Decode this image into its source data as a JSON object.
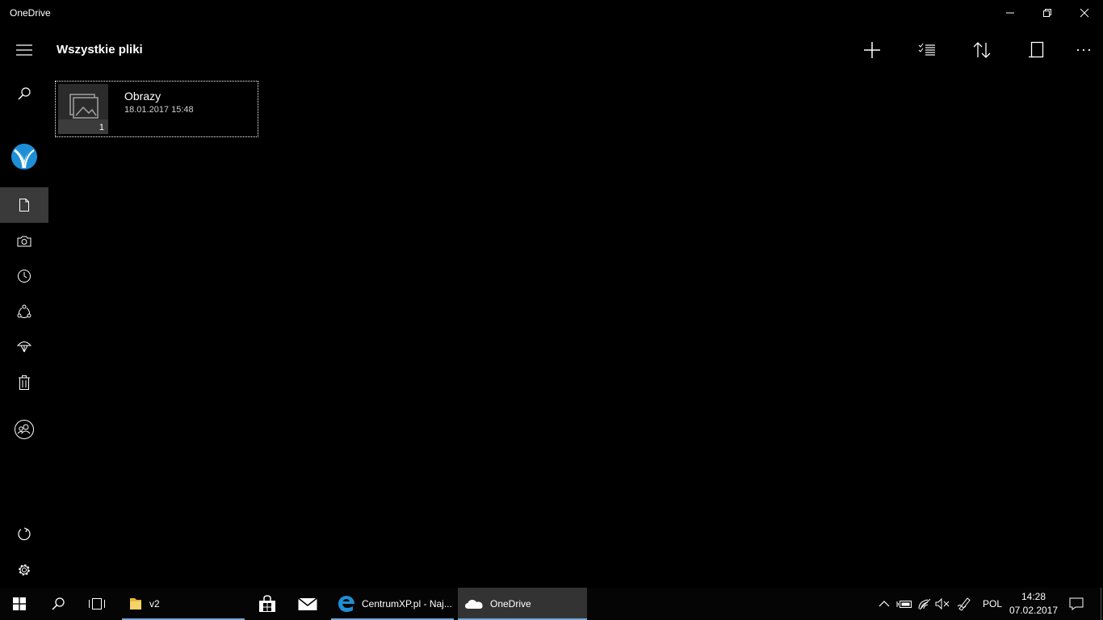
{
  "window": {
    "title": "OneDrive"
  },
  "header": {
    "title": "Wszystkie pliki"
  },
  "nav": {
    "items": [
      {
        "icon": "hamburger-menu-icon"
      },
      {
        "icon": "search-icon"
      },
      {
        "icon": "account-icon"
      },
      {
        "icon": "files-icon",
        "active": true
      },
      {
        "icon": "camera-icon"
      },
      {
        "icon": "recent-icon"
      },
      {
        "icon": "shared-icon"
      },
      {
        "icon": "offline-icon"
      },
      {
        "icon": "recycle-bin-icon"
      },
      {
        "icon": "people-icon"
      },
      {
        "icon": "refresh-icon"
      },
      {
        "icon": "settings-icon"
      }
    ]
  },
  "toolbar": {
    "commands": [
      {
        "icon": "add-icon"
      },
      {
        "icon": "select-icon"
      },
      {
        "icon": "sort-icon"
      },
      {
        "icon": "view-icon"
      },
      {
        "icon": "more-icon"
      }
    ]
  },
  "folders": [
    {
      "name": "Obrazy",
      "date": "18.01.2017 15:48",
      "count": "1"
    }
  ],
  "taskbar": {
    "apps": [
      {
        "label": "v2",
        "icon": "folder-icon"
      },
      {
        "label": "",
        "icon": "store-icon"
      },
      {
        "label": "",
        "icon": "mail-icon"
      },
      {
        "label": "CentrumXP.pl - Naj...",
        "icon": "edge-icon"
      },
      {
        "label": "OneDrive",
        "icon": "onedrive-icon"
      }
    ],
    "tray": {
      "language": "POL",
      "time": "14:28",
      "date": "07.02.2017"
    }
  },
  "colors": {
    "background": "#000000",
    "active_nav": "#3a3a3a",
    "taskbar_underline": "#77a6d6",
    "account_blue": "#1e8fd6"
  }
}
